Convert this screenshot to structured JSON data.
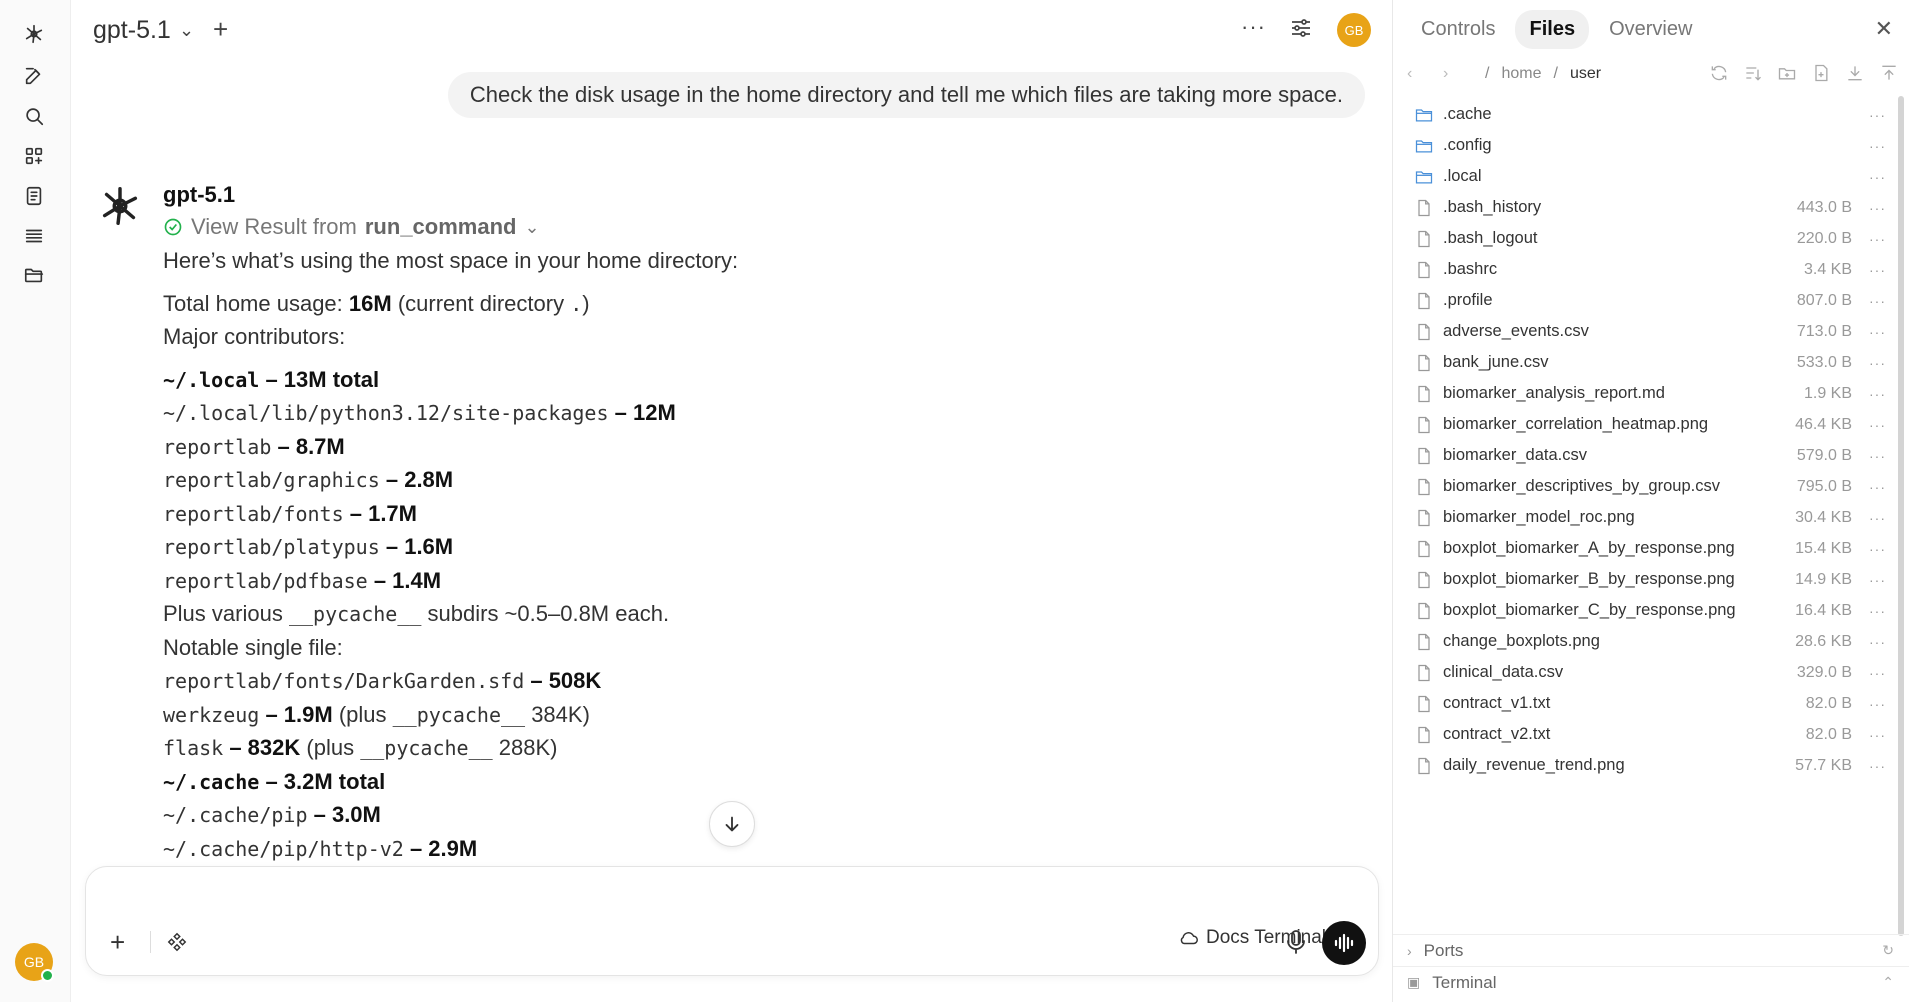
{
  "topbar": {
    "model": "gpt-5.1",
    "avatar_initials": "GB"
  },
  "user_message": "Check the disk usage in the home directory and tell me which files are taking more space.",
  "assistant": {
    "name": "gpt-5.1",
    "tool_prefix": "View Result from",
    "tool_name": "run_command",
    "intro": "Here’s what’s using the most space in your home directory:",
    "total_label": "Total home usage: ",
    "total_value": "16M",
    "total_suffix_1": " (current directory ",
    "total_dot": ".",
    "total_suffix_2": ")",
    "major": "Major contributors:",
    "l1_code": "~/.local",
    "l1_text": " – 13M total",
    "l2_code": "~/.local/lib/python3.12/site-packages",
    "l2_text": " – 12M",
    "l3_code": "reportlab",
    "l3_text": " – 8.7M",
    "l4_code": "reportlab/graphics",
    "l4_text": " – 2.8M",
    "l5_code": "reportlab/fonts",
    "l5_text": " – 1.7M",
    "l6_code": "reportlab/platypus",
    "l6_text": " – 1.6M",
    "l7_code": "reportlab/pdfbase",
    "l7_text": " – 1.4M",
    "plus_prefix": "Plus various ",
    "plus_code": "__pycache__",
    "plus_suffix": " subdirs ~0.5–0.8M each.",
    "notable": "Notable single file:",
    "l8_code": "reportlab/fonts/DarkGarden.sfd",
    "l8_text": " – 508K",
    "l9_code": "werkzeug",
    "l9_text": " – 1.9M",
    "l9_extra_1": " (plus ",
    "l9_extra_code": "__pycache__",
    "l9_extra_2": " 384K)",
    "l10_code": "flask",
    "l10_text": " – 832K",
    "l10_extra_1": " (plus ",
    "l10_extra_code": "__pycache__",
    "l10_extra_2": " 288K)",
    "l11_code": "~/.cache",
    "l11_text": " – 3.2M total",
    "l12_code": "~/.cache/pip",
    "l12_text": " – 3.0M",
    "l13_code": "~/.cache/pip/http-v2",
    "l13_text": " – 2.9M"
  },
  "composer": {
    "placeholder": "",
    "docs_terminal": "Docs Terminal"
  },
  "panel": {
    "tabs": [
      "Controls",
      "Files",
      "Overview"
    ],
    "path": [
      "home",
      "user"
    ],
    "files": [
      {
        "name": ".cache",
        "size": "",
        "type": "folder"
      },
      {
        "name": ".config",
        "size": "",
        "type": "folder"
      },
      {
        "name": ".local",
        "size": "",
        "type": "folder"
      },
      {
        "name": ".bash_history",
        "size": "443.0 B",
        "type": "file"
      },
      {
        "name": ".bash_logout",
        "size": "220.0 B",
        "type": "file"
      },
      {
        "name": ".bashrc",
        "size": "3.4 KB",
        "type": "file"
      },
      {
        "name": ".profile",
        "size": "807.0 B",
        "type": "file"
      },
      {
        "name": "adverse_events.csv",
        "size": "713.0 B",
        "type": "file"
      },
      {
        "name": "bank_june.csv",
        "size": "533.0 B",
        "type": "file"
      },
      {
        "name": "biomarker_analysis_report.md",
        "size": "1.9 KB",
        "type": "file"
      },
      {
        "name": "biomarker_correlation_heatmap.png",
        "size": "46.4 KB",
        "type": "file"
      },
      {
        "name": "biomarker_data.csv",
        "size": "579.0 B",
        "type": "file"
      },
      {
        "name": "biomarker_descriptives_by_group.csv",
        "size": "795.0 B",
        "type": "file"
      },
      {
        "name": "biomarker_model_roc.png",
        "size": "30.4 KB",
        "type": "file"
      },
      {
        "name": "boxplot_biomarker_A_by_response.png",
        "size": "15.4 KB",
        "type": "file"
      },
      {
        "name": "boxplot_biomarker_B_by_response.png",
        "size": "14.9 KB",
        "type": "file"
      },
      {
        "name": "boxplot_biomarker_C_by_response.png",
        "size": "16.4 KB",
        "type": "file"
      },
      {
        "name": "change_boxplots.png",
        "size": "28.6 KB",
        "type": "file"
      },
      {
        "name": "clinical_data.csv",
        "size": "329.0 B",
        "type": "file"
      },
      {
        "name": "contract_v1.txt",
        "size": "82.0 B",
        "type": "file"
      },
      {
        "name": "contract_v2.txt",
        "size": "82.0 B",
        "type": "file"
      },
      {
        "name": "daily_revenue_trend.png",
        "size": "57.7 KB",
        "type": "file"
      }
    ],
    "ports_label": "Ports",
    "terminal_label": "Terminal"
  },
  "colors": {
    "avatar": "#e8a317",
    "folder_icon": "#4a90d9",
    "success": "#22b14c"
  }
}
